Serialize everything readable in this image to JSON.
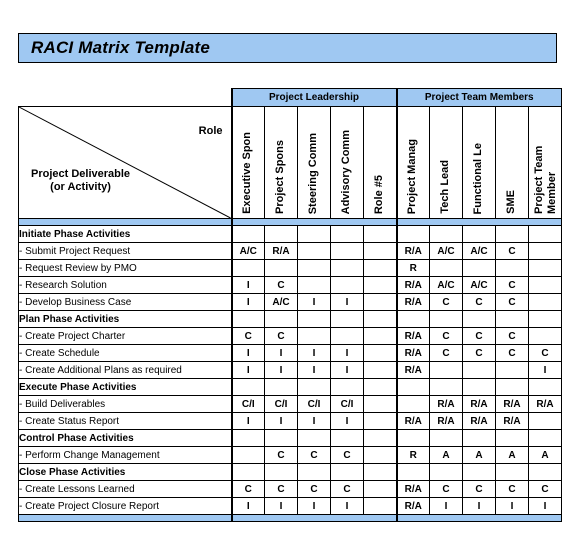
{
  "document": {
    "title": "RACI Matrix Template"
  },
  "matrix": {
    "corner": {
      "role_label": "Role",
      "deliverable_label_line1": "Project Deliverable",
      "deliverable_label_line2": "(or Activity)"
    },
    "groups": [
      {
        "label": "Project Leadership",
        "span": 5
      },
      {
        "label": "Project Team Members",
        "span": 5
      }
    ],
    "role_columns": [
      "Executive Spon",
      "Project Spons",
      "Steering Comm",
      "Advisory Comm",
      "Role #5",
      "Project Manag",
      "Tech Lead",
      "Functional Le",
      "SME",
      "Project Team Member"
    ],
    "rows": [
      {
        "type": "phase",
        "label": "Initiate Phase Activities",
        "values": [
          "",
          "",
          "",
          "",
          "",
          "",
          "",
          "",
          "",
          ""
        ]
      },
      {
        "type": "activity",
        "label": "- Submit Project Request",
        "values": [
          "A/C",
          "R/A",
          "",
          "",
          "",
          "R/A",
          "A/C",
          "A/C",
          "C",
          ""
        ]
      },
      {
        "type": "activity",
        "label": "- Request Review by PMO",
        "values": [
          "",
          "",
          "",
          "",
          "",
          "R",
          "",
          "",
          "",
          ""
        ]
      },
      {
        "type": "activity",
        "label": "- Research Solution",
        "values": [
          "I",
          "C",
          "",
          "",
          "",
          "R/A",
          "A/C",
          "A/C",
          "C",
          ""
        ]
      },
      {
        "type": "activity",
        "label": "- Develop Business Case",
        "values": [
          "I",
          "A/C",
          "I",
          "I",
          "",
          "R/A",
          "C",
          "C",
          "C",
          ""
        ]
      },
      {
        "type": "phase",
        "label": "Plan Phase Activities",
        "values": [
          "",
          "",
          "",
          "",
          "",
          "",
          "",
          "",
          "",
          ""
        ]
      },
      {
        "type": "activity",
        "label": "- Create Project Charter",
        "values": [
          "C",
          "C",
          "",
          "",
          "",
          "R/A",
          "C",
          "C",
          "C",
          ""
        ]
      },
      {
        "type": "activity",
        "label": "- Create Schedule",
        "values": [
          "I",
          "I",
          "I",
          "I",
          "",
          "R/A",
          "C",
          "C",
          "C",
          "C"
        ]
      },
      {
        "type": "activity",
        "label": "- Create Additional Plans as required",
        "values": [
          "I",
          "I",
          "I",
          "I",
          "",
          "R/A",
          "",
          "",
          "",
          "I"
        ]
      },
      {
        "type": "phase",
        "label": "Execute Phase Activities",
        "values": [
          "",
          "",
          "",
          "",
          "",
          "",
          "",
          "",
          "",
          ""
        ]
      },
      {
        "type": "activity",
        "label": "- Build Deliverables",
        "values": [
          "C/I",
          "C/I",
          "C/I",
          "C/I",
          "",
          "",
          "R/A",
          "R/A",
          "R/A",
          "R/A"
        ]
      },
      {
        "type": "activity",
        "label": "- Create Status Report",
        "values": [
          "I",
          "I",
          "I",
          "I",
          "",
          "R/A",
          "R/A",
          "R/A",
          "R/A",
          ""
        ]
      },
      {
        "type": "phase",
        "label": "Control Phase Activities",
        "values": [
          "",
          "",
          "",
          "",
          "",
          "",
          "",
          "",
          "",
          ""
        ]
      },
      {
        "type": "activity",
        "label": " - Perform Change Management",
        "values": [
          "",
          "C",
          "C",
          "C",
          "",
          "R",
          "A",
          "A",
          "A",
          "A"
        ]
      },
      {
        "type": "phase",
        "label": "Close Phase Activities",
        "values": [
          "",
          "",
          "",
          "",
          "",
          "",
          "",
          "",
          "",
          ""
        ]
      },
      {
        "type": "activity",
        "label": "- Create Lessons Learned",
        "values": [
          "C",
          "C",
          "C",
          "C",
          "",
          "R/A",
          "C",
          "C",
          "C",
          "C"
        ]
      },
      {
        "type": "activity",
        "label": "- Create Project Closure Report",
        "values": [
          "I",
          "I",
          "I",
          "I",
          "",
          "R/A",
          "I",
          "I",
          "I",
          "I"
        ]
      }
    ]
  },
  "colors": {
    "band_blue": "#9FC8F2",
    "border": "#000000",
    "text": "#000000"
  }
}
